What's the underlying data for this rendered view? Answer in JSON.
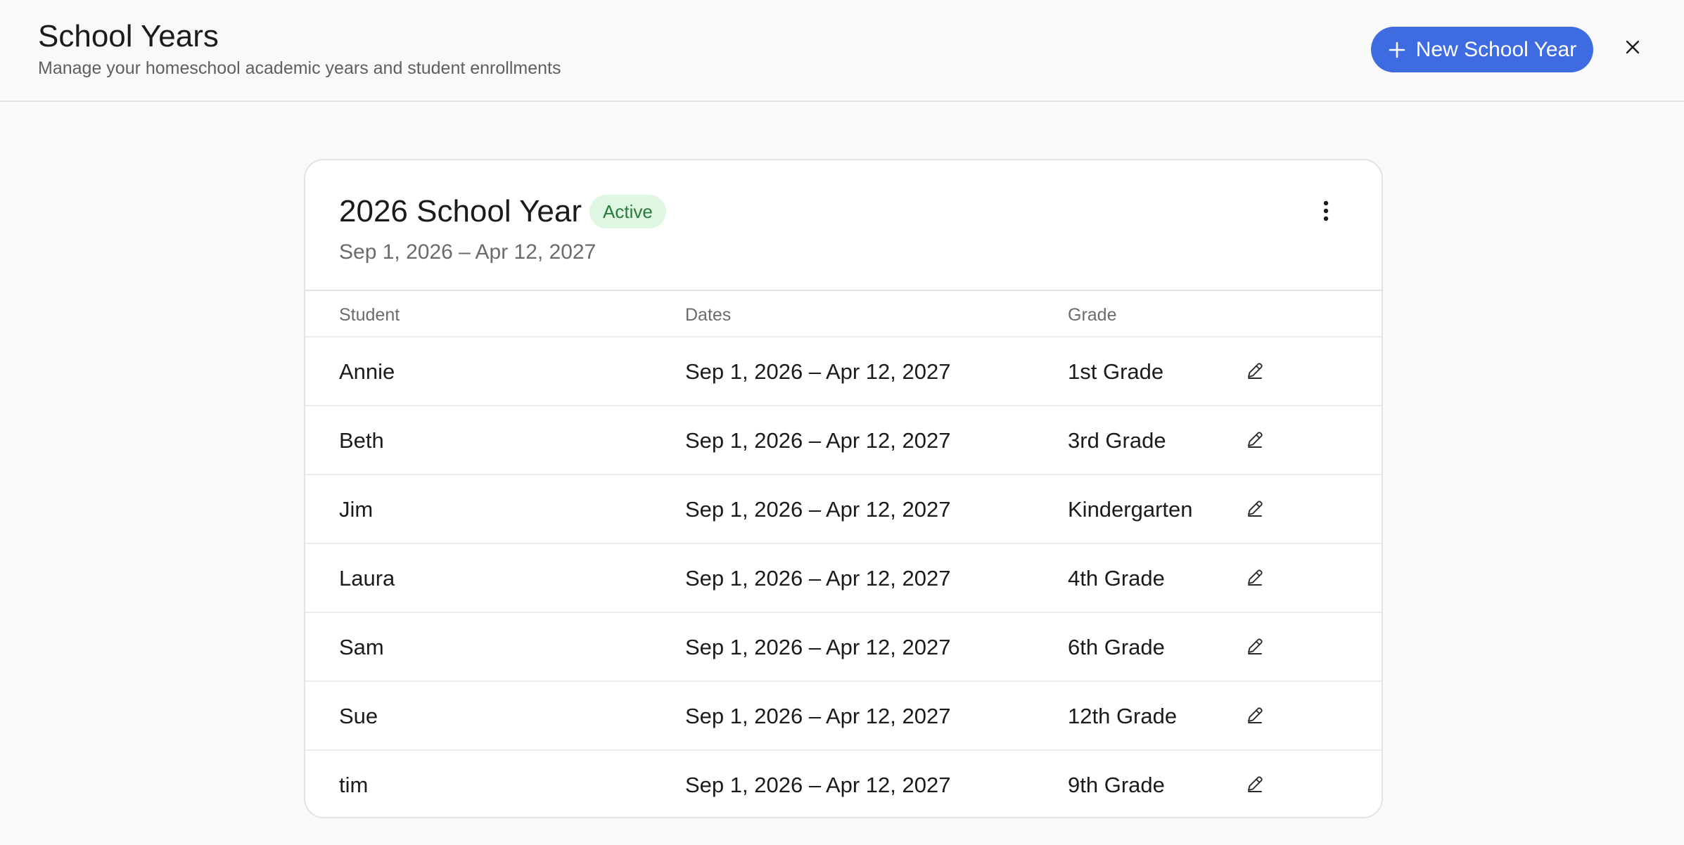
{
  "header": {
    "title": "School Years",
    "subtitle": "Manage your homeschool academic years and student enrollments",
    "new_button_label": "New School Year"
  },
  "school_year": {
    "title": "2026 School Year",
    "status": "Active",
    "dates": "Sep 1, 2026 – Apr 12, 2027",
    "columns": {
      "student": "Student",
      "dates": "Dates",
      "grade": "Grade"
    },
    "enrollments": [
      {
        "student": "Annie",
        "dates": "Sep 1, 2026 – Apr 12, 2027",
        "grade": "1st Grade"
      },
      {
        "student": "Beth",
        "dates": "Sep 1, 2026 – Apr 12, 2027",
        "grade": "3rd Grade"
      },
      {
        "student": "Jim",
        "dates": "Sep 1, 2026 – Apr 12, 2027",
        "grade": "Kindergarten"
      },
      {
        "student": "Laura",
        "dates": "Sep 1, 2026 – Apr 12, 2027",
        "grade": "4th Grade"
      },
      {
        "student": "Sam",
        "dates": "Sep 1, 2026 – Apr 12, 2027",
        "grade": "6th Grade"
      },
      {
        "student": "Sue",
        "dates": "Sep 1, 2026 – Apr 12, 2027",
        "grade": "12th Grade"
      },
      {
        "student": "tim",
        "dates": "Sep 1, 2026 – Apr 12, 2027",
        "grade": "9th Grade"
      }
    ]
  },
  "icons": {
    "new": "plus-icon",
    "close": "close-icon",
    "menu": "more-vertical-icon",
    "edit": "pencil-icon"
  },
  "colors": {
    "accent": "#3f6be0",
    "badge_bg": "#dff6e2",
    "badge_text": "#2b7a3b"
  }
}
